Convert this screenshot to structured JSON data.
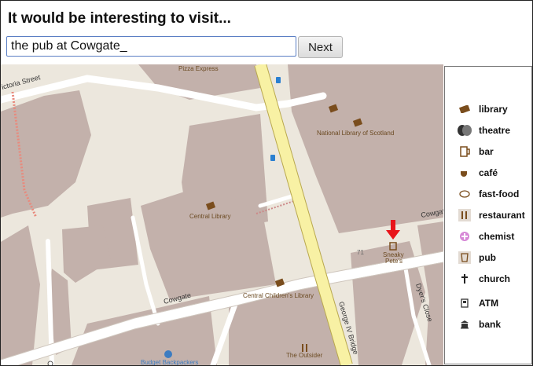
{
  "header": {
    "title": "It would be interesting to visit...",
    "answer_value": "the pub at Cowgate_",
    "next_label": "Next"
  },
  "map": {
    "places": {
      "pizza_express": "Pizza Express",
      "national_library": "National Library of Scotland",
      "central_library": "Central Library",
      "central_childrens_library": "Central Children's Library",
      "sneaky_petes_line1": "Sneaky",
      "sneaky_petes_line2": "Pete's",
      "the_outsider": "The Outsider",
      "budget_backpackers": "Budget Backpackers",
      "house_number": "71"
    },
    "roads": {
      "victoria_street": "ictoria Street",
      "cowgate_west": "Cowgate",
      "cowgate_east": "Cowgat",
      "george_iv_bridge": "George IV Bridge",
      "dyers_close": "Dyer's Close"
    },
    "icons": [
      "library-icon",
      "bus-stop-icon",
      "pub-icon",
      "restaurant-icon",
      "tourism-icon",
      "pointer-arrow-icon"
    ],
    "colors": {
      "building": "#c3b1ab",
      "land": "#ece7dd",
      "major_road": "#f8f1a4",
      "minor_road": "#ffffff",
      "pointer": "#e8141a",
      "poi": "#7a4d1d"
    }
  },
  "legend": {
    "items": [
      {
        "label": "library",
        "icon": "library-icon"
      },
      {
        "label": "theatre",
        "icon": "theatre-icon"
      },
      {
        "label": "bar",
        "icon": "bar-icon"
      },
      {
        "label": "café",
        "icon": "cafe-icon"
      },
      {
        "label": "fast-food",
        "icon": "fast-food-icon"
      },
      {
        "label": "restaurant",
        "icon": "restaurant-icon"
      },
      {
        "label": "chemist",
        "icon": "chemist-icon"
      },
      {
        "label": "pub",
        "icon": "pub-icon"
      },
      {
        "label": "church",
        "icon": "church-icon"
      },
      {
        "label": "ATM",
        "icon": "atm-icon"
      },
      {
        "label": "bank",
        "icon": "bank-icon"
      }
    ]
  }
}
